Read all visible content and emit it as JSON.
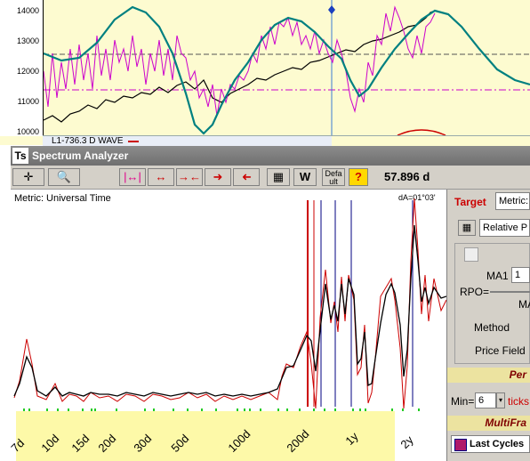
{
  "top_chart": {
    "y_ticks": [
      "14000",
      "13000",
      "12000",
      "11000",
      "10000"
    ],
    "footer_label": "L1-736.3 D WAVE",
    "colors": {
      "price": "#000000",
      "cycle": "#cc00cc",
      "wave": "#008080",
      "background": "#fdfbd0"
    }
  },
  "window": {
    "logo": "Ts",
    "title": "Spectrum Analyzer"
  },
  "toolbar": {
    "icons": [
      "crosshair-icon",
      "zoom-icon",
      "range-expand-icon",
      "range-arrows-icon",
      "range-contract-icon",
      "arrow-right-icon",
      "arrow-left-icon",
      "pattern-icon",
      "w-icon",
      "default-icon",
      "help-icon"
    ],
    "w_label": "W",
    "default_label": "Defa ult",
    "help_label": "?",
    "period_readout": "57.896 d"
  },
  "spectrum": {
    "metric_label": "Metric: Universal Time",
    "da_label": "dA=01°03'",
    "x_labels": [
      "7d",
      "10d",
      "15d",
      "20d",
      "30d",
      "50d",
      "100d",
      "200d",
      "1y",
      "2y"
    ],
    "colors": {
      "raw": "#cc0000",
      "smoothed": "#000000",
      "marker_red": "#cc0000",
      "marker_blue": "#000080",
      "ticks": "#22cc22"
    }
  },
  "side": {
    "target_label": "Target",
    "metric_value": "Metric:",
    "relative_value": "Relative P",
    "ma1_label": "MA1",
    "ma1_value": "1",
    "rpo_label": "RPO=",
    "ma_label": "MA",
    "method_label": "Method",
    "price_field_label": "Price Field",
    "per_band": "Per",
    "min_label": "Min=",
    "min_value": "6",
    "ticks_label": "ticks",
    "multifra_band": "MultiFra",
    "last_cycles_label": "Last Cycles"
  }
}
